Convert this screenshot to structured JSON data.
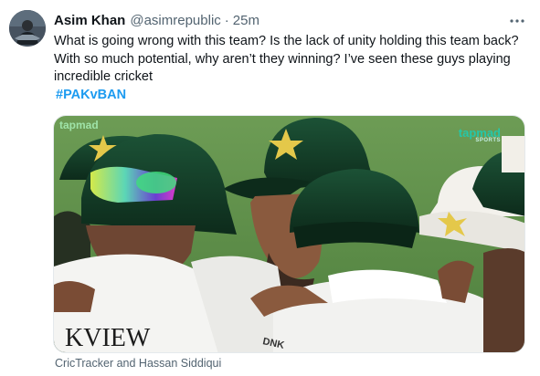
{
  "author": {
    "name": "Asim Khan",
    "handle": "@asimrepublic",
    "separator": "·",
    "time": "25m"
  },
  "tweet": {
    "text": "What is going wrong with this team? Is the lack of unity holding this team back? With so much potential, why aren’t they winning? I’ve seen these guys playing incredible cricket",
    "hashtag": "#PAKvBAN"
  },
  "media": {
    "watermark_left": "tapmad",
    "watermark_right": "tapmad",
    "watermark_right_sub": "SPORTS",
    "shirt_text_left": "KVIEW",
    "shirt_text_right": "DNK",
    "credit": "CricTracker and Hassan Siddiqui"
  },
  "colors": {
    "link": "#1d9bf0",
    "secondary_text": "#536471",
    "cap_green": "#123b26",
    "star_gold": "#e4c84a",
    "field_green": "#5a8f47"
  },
  "icons": {
    "more": "more-horizontal-icon"
  }
}
